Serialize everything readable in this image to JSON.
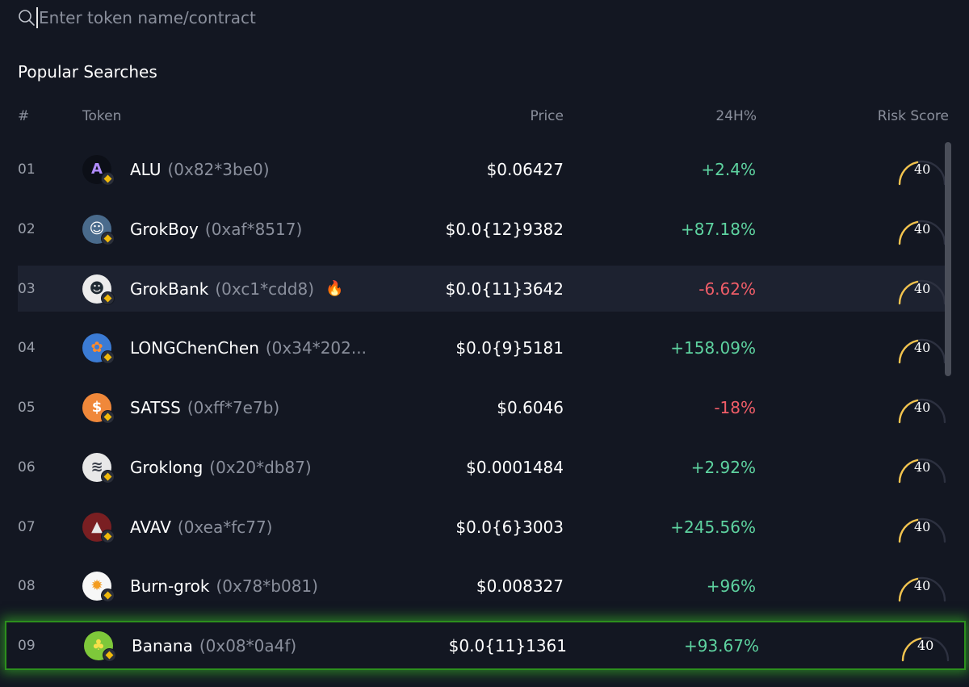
{
  "search": {
    "placeholder": "Enter token name/contract"
  },
  "section_title": "Popular Searches",
  "columns": {
    "num": "#",
    "token": "Token",
    "price": "Price",
    "change": "24H%",
    "risk": "Risk Score"
  },
  "colors": {
    "positive": "#5ed3a0",
    "negative": "#f05d68",
    "gauge_active": "#f3c44e",
    "highlight": "#2c8f1d"
  },
  "tokens": [
    {
      "num": "01",
      "name": "ALU",
      "address": "(0x82*3be0)",
      "price": "$0.06427",
      "change": "+2.4%",
      "direction": "up",
      "risk": "40",
      "logo": "alu-logo-icon"
    },
    {
      "num": "02",
      "name": "GrokBoy",
      "address": "(0xaf*8517)",
      "price": "$0.0{12}9382",
      "change": "+87.18%",
      "direction": "up",
      "risk": "40",
      "logo": "grokboy-logo-icon"
    },
    {
      "num": "03",
      "name": "GrokBank",
      "address": "(0xc1*cdd8)",
      "price": "$0.0{11}3642",
      "change": "-6.62%",
      "direction": "down",
      "risk": "40",
      "logo": "grokbank-logo-icon",
      "hot": true
    },
    {
      "num": "04",
      "name": "LONGChenChen",
      "address": "(0x34*202...",
      "price": "$0.0{9}5181",
      "change": "+158.09%",
      "direction": "up",
      "risk": "40",
      "logo": "longchenchen-logo-icon"
    },
    {
      "num": "05",
      "name": "SATSS",
      "address": "(0xff*7e7b)",
      "price": "$0.6046",
      "change": "-18%",
      "direction": "down",
      "risk": "40",
      "logo": "satss-logo-icon"
    },
    {
      "num": "06",
      "name": "Groklong",
      "address": "(0x20*db87)",
      "price": "$0.0001484",
      "change": "+2.92%",
      "direction": "up",
      "risk": "40",
      "logo": "groklong-logo-icon"
    },
    {
      "num": "07",
      "name": "AVAV",
      "address": "(0xea*fc77)",
      "price": "$0.0{6}3003",
      "change": "+245.56%",
      "direction": "up",
      "risk": "40",
      "logo": "avav-logo-icon"
    },
    {
      "num": "08",
      "name": "Burn-grok",
      "address": "(0x78*b081)",
      "price": "$0.008327",
      "change": "+96%",
      "direction": "up",
      "risk": "40",
      "logo": "burn-grok-logo-icon"
    },
    {
      "num": "09",
      "name": "Banana",
      "address": "(0x08*0a4f)",
      "price": "$0.0{11}1361",
      "change": "+93.67%",
      "direction": "up",
      "risk": "40",
      "logo": "banana-logo-icon",
      "highlighted": true
    }
  ]
}
